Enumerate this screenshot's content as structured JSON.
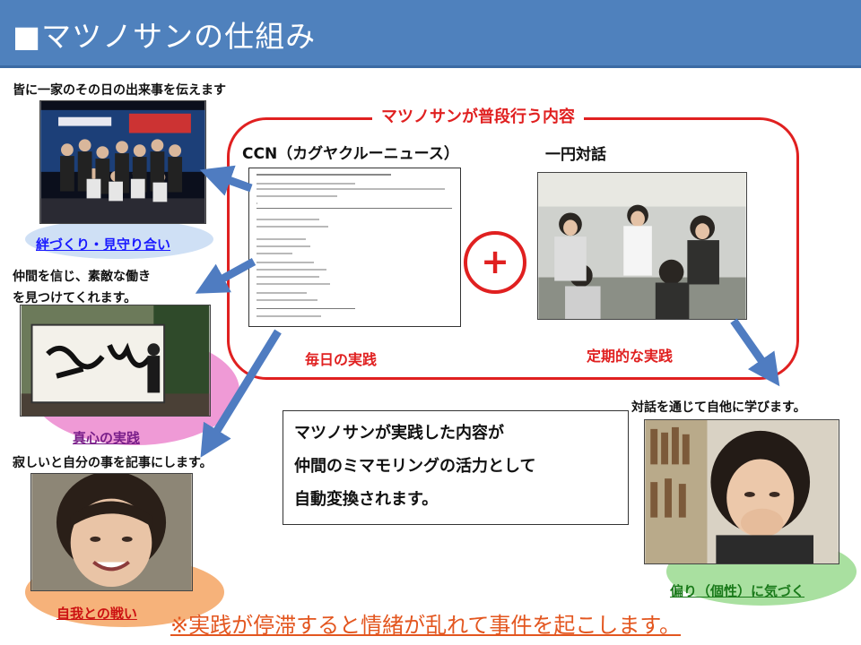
{
  "title": "■マツノサンの仕組み",
  "frame_title": "マツノサンが普段行う内容",
  "ccn_label": "CCN（カグヤクルーニュース）",
  "taiwa_label": "一円対話",
  "plus_symbol": "+",
  "daily_label": "毎日の実践",
  "regular_label": "定期的な実践",
  "left_items": [
    {
      "caption": "皆に一家のその日の出来事を伝えます",
      "label": "絆づくり・見守り合い",
      "label_color": "#1a1aff",
      "ellipse_color": "#cfe0f5"
    },
    {
      "caption_lines": [
        "仲間を信じ、素敵な働き",
        "を見つけてくれます。"
      ],
      "label": "真心の実践",
      "label_color": "#7a1f8a",
      "ellipse_color": "#ef9ad6"
    },
    {
      "caption": "寂しいと自分の事を記事にします。",
      "label": "自我との戦い",
      "label_color": "#cc1111",
      "ellipse_color": "#f6b27a"
    }
  ],
  "right_item": {
    "caption": "対話を通じて自他に学びます。",
    "label": "偏り（個性）に気づく",
    "label_color": "#1a7a1a",
    "ellipse_color": "#a9e0a0"
  },
  "info_box_lines": [
    "マツノサンが実践した内容が",
    "仲間のミマモリングの活力として",
    "自動変換されます。"
  ],
  "footer_note": "※実践が停滞すると情緒が乱れて事件を起こします。",
  "colors": {
    "title_bar": "#4f81bd",
    "accent_red": "#e02020",
    "arrow_blue": "#4f7cc1",
    "footer": "#e3561f"
  },
  "photos": {
    "group_photo": "group-photo",
    "calligraphy_photo": "calligraphy-photo",
    "smiling_woman_photo": "smiling-woman-photo",
    "dialogue_photo": "dialogue-circle-photo",
    "thinking_woman_photo": "thinking-woman-photo",
    "email_screenshot": "email-screenshot"
  }
}
